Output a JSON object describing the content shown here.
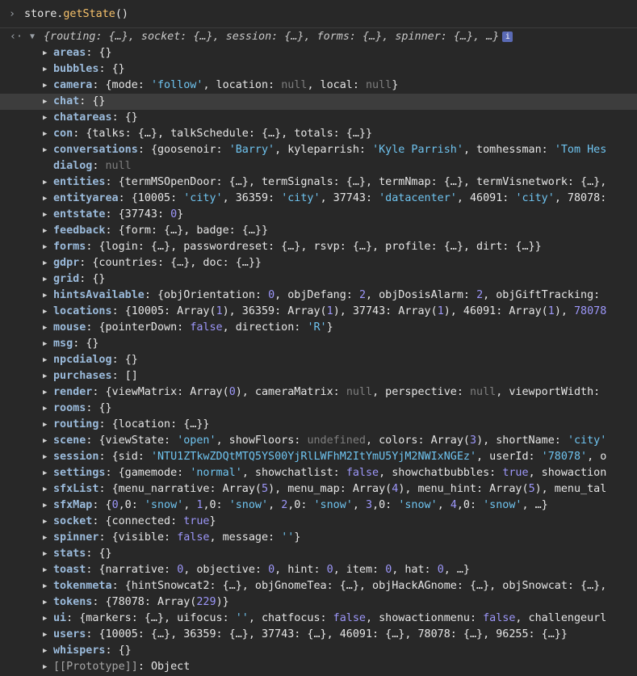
{
  "input": {
    "chevron": "›",
    "object": "store.",
    "method": "getState",
    "parens": "()"
  },
  "result": {
    "back_arrow": "‹·",
    "summary": "{routing: {…}, socket: {…}, session: {…}, forms: {…}, spinner: {…}, …}",
    "info": "i"
  },
  "props": [
    {
      "key": "areas",
      "value": "{}",
      "expand": true
    },
    {
      "key": "bubbles",
      "value": "{}",
      "expand": true
    },
    {
      "key": "camera",
      "value": "{mode: 'follow', location: null, local: null}",
      "expand": true
    },
    {
      "key": "chat",
      "value": "{}",
      "expand": true,
      "hl": true
    },
    {
      "key": "chatareas",
      "value": "{}",
      "expand": true
    },
    {
      "key": "con",
      "value": "{talks: {…}, talkSchedule: {…}, totals: {…}}",
      "expand": true
    },
    {
      "key": "conversations",
      "value": "{goosenoir: 'Barry', kyleparrish: 'Kyle Parrish', tomhessman: 'Tom Hes",
      "expand": true
    },
    {
      "key": "dialog",
      "value": "null",
      "expand": false
    },
    {
      "key": "entities",
      "value": "{termMSOpenDoor: {…}, termSignals: {…}, termNmap: {…}, termVisnetwork: {…},",
      "expand": true
    },
    {
      "key": "entityarea",
      "value": "{10005: 'city', 36359: 'city', 37743: 'datacenter', 46091: 'city', 78078:",
      "expand": true
    },
    {
      "key": "entstate",
      "value": "{37743: 0}",
      "expand": true
    },
    {
      "key": "feedback",
      "value": "{form: {…}, badge: {…}}",
      "expand": true
    },
    {
      "key": "forms",
      "value": "{login: {…}, passwordreset: {…}, rsvp: {…}, profile: {…}, dirt: {…}}",
      "expand": true
    },
    {
      "key": "gdpr",
      "value": "{countries: {…}, doc: {…}}",
      "expand": true
    },
    {
      "key": "grid",
      "value": "{}",
      "expand": true
    },
    {
      "key": "hintsAvailable",
      "value": "{objOrientation: 0, objDefang: 2, objDosisAlarm: 2, objGiftTracking:",
      "expand": true
    },
    {
      "key": "locations",
      "value": "{10005: Array(1), 36359: Array(1), 37743: Array(1), 46091: Array(1), 78078",
      "expand": true
    },
    {
      "key": "mouse",
      "value": "{pointerDown: false, direction: 'R'}",
      "expand": true
    },
    {
      "key": "msg",
      "value": "{}",
      "expand": true
    },
    {
      "key": "npcdialog",
      "value": "{}",
      "expand": true
    },
    {
      "key": "purchases",
      "value": "[]",
      "expand": true
    },
    {
      "key": "render",
      "value": "{viewMatrix: Array(0), cameraMatrix: null, perspective: null, viewportWidth:",
      "expand": true
    },
    {
      "key": "rooms",
      "value": "{}",
      "expand": true
    },
    {
      "key": "routing",
      "value": "{location: {…}}",
      "expand": true
    },
    {
      "key": "scene",
      "value": "{viewState: 'open', showFloors: undefined, colors: Array(3), shortName: 'city'",
      "expand": true
    },
    {
      "key": "session",
      "value": "{sid: 'NTU1ZTkwZDQtMTQ5YS00YjRlLWFhM2ItYmU5YjM2NWIxNGEz', userId: '78078', o",
      "expand": true
    },
    {
      "key": "settings",
      "value": "{gamemode: 'normal', showchatlist: false, showchatbubbles: true, showaction",
      "expand": true
    },
    {
      "key": "sfxList",
      "value": "{menu_narrative: Array(5), menu_map: Array(4), menu_hint: Array(5), menu_tal",
      "expand": true
    },
    {
      "key": "sfxMap",
      "value": "{0,0: 'snow', 1,0: 'snow', 2,0: 'snow', 3,0: 'snow', 4,0: 'snow', …}",
      "expand": true
    },
    {
      "key": "socket",
      "value": "{connected: true}",
      "expand": true
    },
    {
      "key": "spinner",
      "value": "{visible: false, message: ''}",
      "expand": true
    },
    {
      "key": "stats",
      "value": "{}",
      "expand": true
    },
    {
      "key": "toast",
      "value": "{narrative: 0, objective: 0, hint: 0, item: 0, hat: 0, …}",
      "expand": true
    },
    {
      "key": "tokenmeta",
      "value": "{hintSnowcat2: {…}, objGnomeTea: {…}, objHackAGnome: {…}, objSnowcat: {…},",
      "expand": true
    },
    {
      "key": "tokens",
      "value": "{78078: Array(229)}",
      "expand": true
    },
    {
      "key": "ui",
      "value": "{markers: {…}, uifocus: '', chatfocus: false, showactionmenu: false, challengeurl",
      "expand": true
    },
    {
      "key": "users",
      "value": "{10005: {…}, 36359: {…}, 37743: {…}, 46091: {…}, 78078: {…}, 96255: {…}}",
      "expand": true
    },
    {
      "key": "whispers",
      "value": "{}",
      "expand": true
    },
    {
      "key": "[[Prototype]]",
      "value": "Object",
      "expand": true,
      "proto": true
    }
  ]
}
